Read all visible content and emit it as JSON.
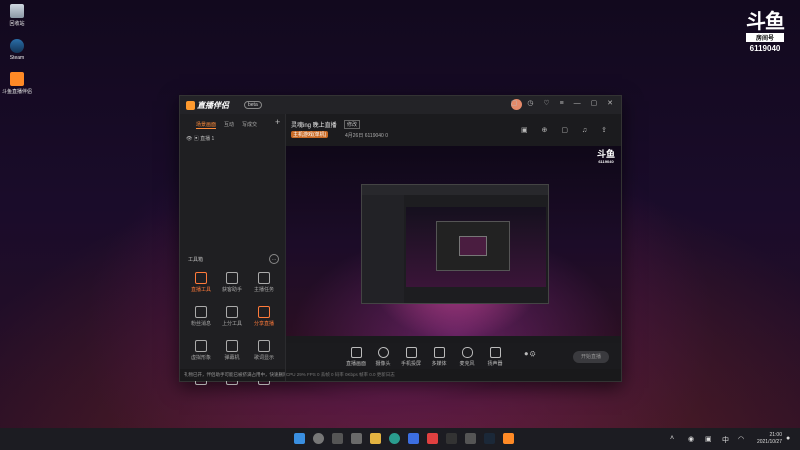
{
  "desktop": {
    "icons": [
      {
        "label": "回收站"
      },
      {
        "label": "Steam"
      },
      {
        "label": "斗鱼直播伴侣"
      }
    ],
    "watermark": {
      "logo": "斗鱼",
      "tag": "房间号",
      "room": "6119040"
    }
  },
  "app": {
    "brand": "直播伴侣",
    "version": "beta",
    "left_tabs": [
      "场景画面",
      "互动",
      "写成交"
    ],
    "scene": "直播 1",
    "tools_header": "工具箱",
    "tools": [
      {
        "label": "直播工具",
        "active": true
      },
      {
        "label": "获客助手",
        "active": false
      },
      {
        "label": "主播任务",
        "active": false
      },
      {
        "label": "粉丝消息",
        "active": false
      },
      {
        "label": "上分工具",
        "active": false
      },
      {
        "label": "分享直播",
        "active": true
      },
      {
        "label": "虚拟形象",
        "active": false
      },
      {
        "label": "弹幕机",
        "active": false
      },
      {
        "label": "歌词显示",
        "active": false
      },
      {
        "label": "打鼓",
        "active": false
      },
      {
        "label": "下载",
        "active": false
      },
      {
        "label": "更多",
        "active": false
      }
    ],
    "left_status": "礼物已开，伴侣助手可能已被挤满占用中，快速删除",
    "room_title": "灵魂ing 晚上直播",
    "room_badge": "修改",
    "room_tag": "主机游戏(单机)",
    "room_meta": "4月26日  6119040  0",
    "bottom_tools": [
      "直播画面",
      "摄像头",
      "手机投屏",
      "多媒体",
      "麦克风",
      "扬声器"
    ],
    "go_live": "开始直播",
    "right_status": "CPU 29%   FPS 0   丢帧 0   码率 0Kbps   帧率 0.0   更新日志"
  },
  "taskbar": {
    "time": "21:00",
    "date": "2021/10/27",
    "lang": "中"
  }
}
